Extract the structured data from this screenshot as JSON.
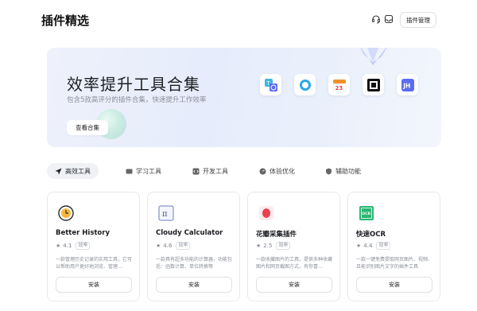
{
  "header": {
    "title": "插件精选",
    "manage_label": "插件管理"
  },
  "banner": {
    "title": "效率提升工具合集",
    "subtitle": "包含5款高评分的插件合集，快速提升工作效率",
    "button_label": "查看合集",
    "app_icons": [
      "translate-app-icon",
      "ring-app-icon",
      "calendar-app-icon",
      "qr-app-icon",
      "jh-app-icon"
    ],
    "calendar_number": "23",
    "jh_text": "JH"
  },
  "tabs": [
    {
      "label": "高效工具",
      "icon": "send-icon",
      "active": true
    },
    {
      "label": "学习工具",
      "icon": "book-icon",
      "active": false
    },
    {
      "label": "开发工具",
      "icon": "code-icon",
      "active": false
    },
    {
      "label": "体验优化",
      "icon": "gauge-icon",
      "active": false
    },
    {
      "label": "辅助功能",
      "icon": "shield-icon",
      "active": false
    }
  ],
  "plugins": [
    {
      "name": "Better History",
      "rating": "4.1",
      "tag": "效率",
      "desc": "一款管理历史记录的实用工具，它可以帮助用户更好地浏览、管理…",
      "install": "安装",
      "icon": "clock-icon"
    },
    {
      "name": "Cloudy Calculator",
      "rating": "4.6",
      "tag": "效率",
      "desc": "一款具有超多功能的计算器，功能包括：函数计算、单位转换等",
      "install": "安装",
      "icon": "pi-calculator-icon"
    },
    {
      "name": "花瓣采集插件",
      "rating": "2.5",
      "tag": "效率",
      "desc": "一款收藏图片的工具，提供多种收藏图片和网页截图方式，有你喜…",
      "install": "安装",
      "icon": "petal-icon"
    },
    {
      "name": "快速OCR",
      "rating": "4.4",
      "tag": "效率",
      "desc": "一款一键免费提取网页图片、视频、且能识别图片文字的插件工具",
      "install": "安装",
      "icon": "ocr-icon"
    }
  ],
  "colors": {
    "accent_green": "#2bb673",
    "petal_red": "#e8424f",
    "jh_blue": "#5b6cf0",
    "banner_bg": "#e7edfb"
  }
}
